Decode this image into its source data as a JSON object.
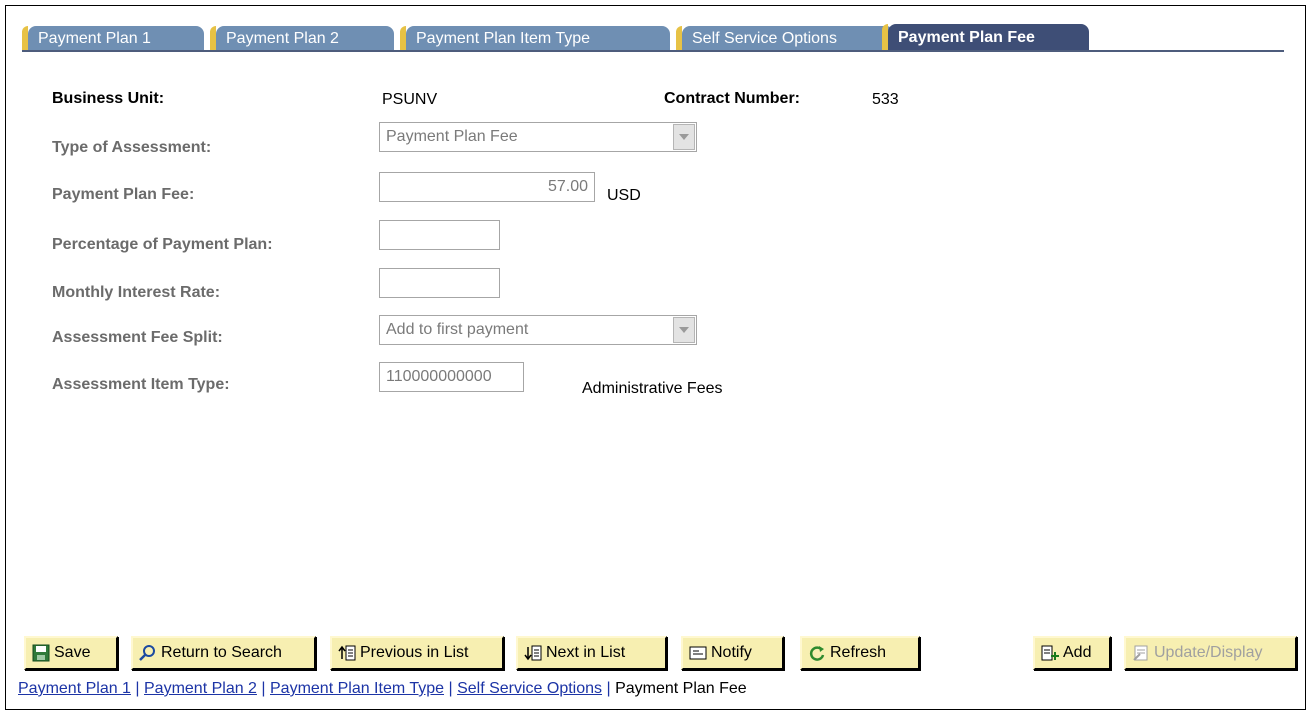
{
  "tabs": [
    {
      "label": "Payment Plan 1",
      "active": false
    },
    {
      "label": "Payment Plan 2",
      "active": false
    },
    {
      "label": "Payment Plan Item Type",
      "active": false
    },
    {
      "label": "Self Service Options",
      "active": false
    },
    {
      "label": "Payment Plan Fee",
      "active": true
    }
  ],
  "form": {
    "business_unit_label": "Business Unit:",
    "business_unit_value": "PSUNV",
    "contract_number_label": "Contract Number:",
    "contract_number_value": "533",
    "type_of_assessment_label": "Type of Assessment:",
    "type_of_assessment_value": "Payment Plan Fee",
    "payment_plan_fee_label": "Payment Plan Fee:",
    "payment_plan_fee_value": "57.00",
    "currency": "USD",
    "percentage_label": "Percentage of Payment Plan:",
    "percentage_value": "",
    "monthly_interest_label": "Monthly Interest Rate:",
    "monthly_interest_value": "",
    "fee_split_label": "Assessment Fee Split:",
    "fee_split_value": "Add to first payment",
    "item_type_label": "Assessment Item Type:",
    "item_type_value": "110000000000",
    "item_type_description": "Administrative Fees"
  },
  "toolbar": {
    "save": "Save",
    "return_to_search": "Return to Search",
    "previous_in_list": "Previous in List",
    "next_in_list": "Next in List",
    "notify": "Notify",
    "refresh": "Refresh",
    "add": "Add",
    "update_display": "Update/Display"
  },
  "footer_links": {
    "link1": "Payment Plan 1",
    "link2": "Payment Plan 2",
    "link3": "Payment Plan Item Type",
    "link4": "Self Service Options",
    "current": "Payment Plan Fee",
    "separator": " | "
  },
  "colors": {
    "tab_inactive": "#6f8fb3",
    "tab_active": "#3e4e76",
    "button_bg": "#f7efb1",
    "link": "#1c34a6"
  }
}
